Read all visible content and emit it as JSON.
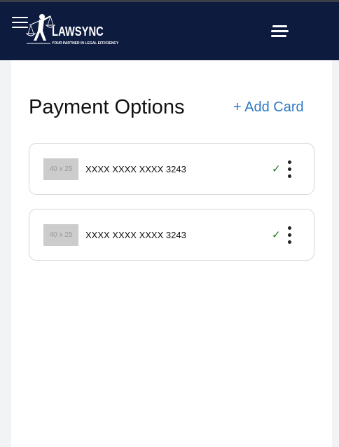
{
  "header": {
    "logo": {
      "word": "LAWSYNC",
      "tagline": "YOUR PARTNER IN LEGAL EFFICIENCY"
    },
    "icons": {
      "left_menu": "hamburger-menu-icon",
      "right_menu": "menu-icon"
    }
  },
  "main": {
    "title": "Payment Options",
    "add_card_label": "+ Add Card",
    "cards": [
      {
        "thumb_text": "40 x 25",
        "number": "XXXX XXXX XXXX 3243",
        "status_icon": "check-icon",
        "status_symbol": "✓"
      },
      {
        "thumb_text": "40 x 25",
        "number": "XXXX XXXX XXXX 3243",
        "status_icon": "check-icon",
        "status_symbol": "✓"
      }
    ]
  },
  "colors": {
    "header_bg": "#0d1b3e",
    "link": "#2f79c2",
    "check": "#1a7a1a"
  }
}
